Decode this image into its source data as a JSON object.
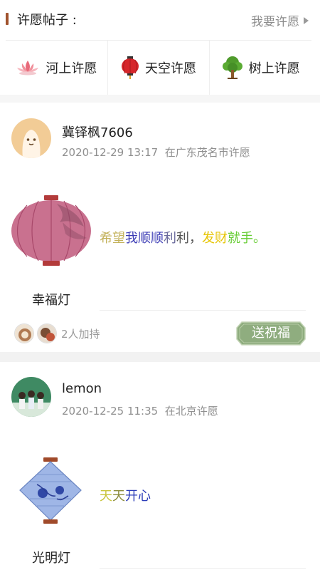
{
  "header": {
    "title": "许愿帖子 :",
    "action_label": "我要许愿"
  },
  "tabs": [
    {
      "label": "河上许愿",
      "icon": "lotus-lantern-icon"
    },
    {
      "label": "天空许愿",
      "icon": "sky-lantern-icon"
    },
    {
      "label": "树上许愿",
      "icon": "wishing-tree-icon"
    }
  ],
  "posts": [
    {
      "username": "冀铎枫7606",
      "datetime": "2020-12-29 13:17",
      "location": "在广东茂名市许愿",
      "wish_segments": [
        {
          "text": "希望",
          "color": "#c3b15a"
        },
        {
          "text": "我顺顺",
          "color": "#3b3bb5"
        },
        {
          "text": "利",
          "color": "#6a6a9c"
        },
        {
          "text": "利，",
          "color": "#555555"
        },
        {
          "text": "发财",
          "color": "#e6c400"
        },
        {
          "text": "就手。",
          "color": "#66cc33"
        }
      ],
      "lantern_name": "幸福灯",
      "supporters_count_text": "2人加持",
      "bless_button": "送祝福"
    },
    {
      "username": "lemon",
      "datetime": "2020-12-25 11:35",
      "location": "在北京许愿",
      "wish_segments": [
        {
          "text": "天",
          "color": "#c8c43a"
        },
        {
          "text": "天",
          "color": "#8c8c3c"
        },
        {
          "text": "开心",
          "color": "#2a3bb8"
        }
      ],
      "lantern_name": "光明灯"
    }
  ],
  "colors": {
    "accent_bar": "#a0522d",
    "bless_button_bg": "#8fad7f"
  }
}
